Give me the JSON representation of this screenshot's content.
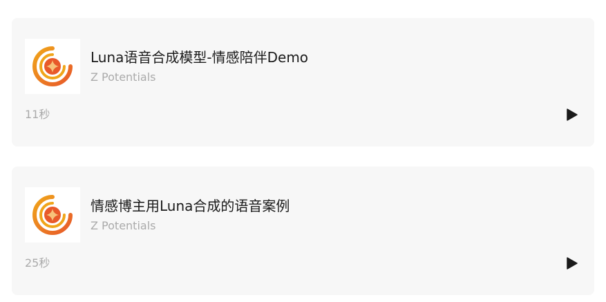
{
  "tracks": [
    {
      "title": "Luna语音合成模型-情感陪伴Demo",
      "author": "Z Potentials",
      "duration": "11秒",
      "cover_icon": "z-potentials-logo-icon",
      "play_icon": "play-icon"
    },
    {
      "title": "情感博主用Luna合成的语音案例",
      "author": "Z Potentials",
      "duration": "25秒",
      "cover_icon": "z-potentials-logo-icon",
      "play_icon": "play-icon"
    }
  ],
  "colors": {
    "card_background": "#f7f7f7",
    "title_text": "#1a1a1a",
    "secondary_text": "#aaaaaa",
    "logo_orange": "#e8592a",
    "logo_gold": "#f0a51a",
    "play_icon": "#1a1a1a"
  }
}
